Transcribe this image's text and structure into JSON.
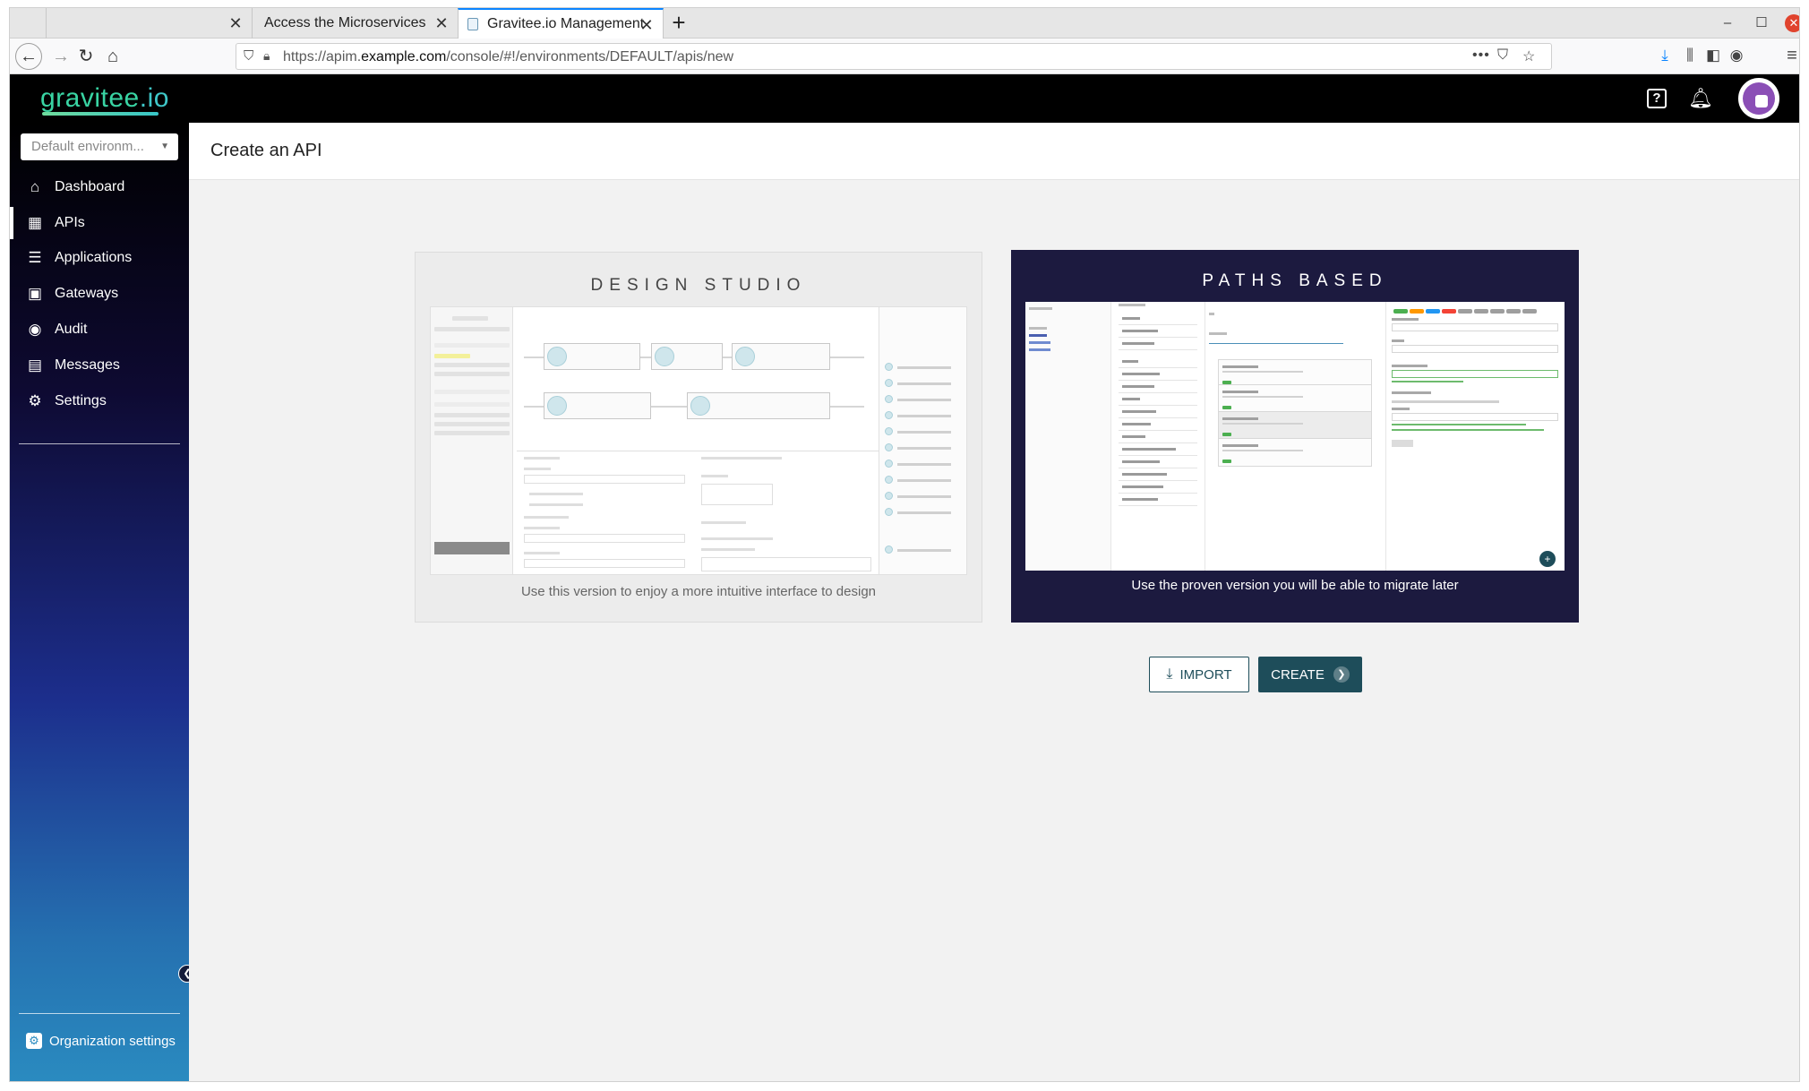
{
  "browser": {
    "tabs": [
      {
        "label": ""
      },
      {
        "label": "Access the Microservices fro"
      },
      {
        "label": "Gravitee.io Management"
      }
    ],
    "url_prefix": "https://apim.",
    "url_domain": "example.com",
    "url_path": "/console/#!/environments/DEFAULT/apis/new"
  },
  "header": {
    "logo_main": "gravitee",
    "logo_suffix": ".io"
  },
  "sidebar": {
    "environment": "Default environm...",
    "items": [
      {
        "label": "Dashboard",
        "icon": "home-icon"
      },
      {
        "label": "APIs",
        "icon": "dashboard-icon"
      },
      {
        "label": "Applications",
        "icon": "list-icon"
      },
      {
        "label": "Gateways",
        "icon": "gateway-icon"
      },
      {
        "label": "Audit",
        "icon": "eye-icon"
      },
      {
        "label": "Messages",
        "icon": "message-icon"
      },
      {
        "label": "Settings",
        "icon": "gear-icon"
      }
    ],
    "org_settings": "Organization settings"
  },
  "page": {
    "title": "Create an API"
  },
  "cards": {
    "design_studio": {
      "title": "DESIGN STUDIO",
      "caption": "Use this version to enjoy a more intuitive interface to design"
    },
    "paths_based": {
      "title": "PATHS BASED",
      "caption": "Use the proven version you will be able to migrate later"
    }
  },
  "actions": {
    "import_label": "IMPORT",
    "create_label": "CREATE"
  },
  "colors": {
    "header_bg": "#000000",
    "accent_teal": "#1e4d5a",
    "paths_card_bg": "#1c1a3f",
    "logo_green": "#39d4a3"
  }
}
